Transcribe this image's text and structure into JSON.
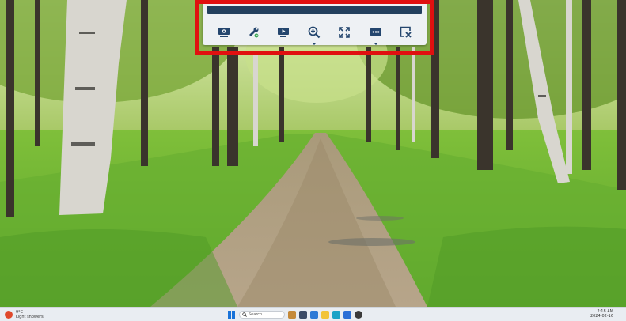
{
  "toolbar": {
    "title": "",
    "buttons": [
      {
        "name": "monitor-settings",
        "icon": "monitor-gear-icon"
      },
      {
        "name": "remote-tools",
        "icon": "wrench-screwdriver-icon"
      },
      {
        "name": "display-options",
        "icon": "screen-play-icon"
      },
      {
        "name": "zoom",
        "icon": "zoom-in-icon"
      },
      {
        "name": "fullscreen",
        "icon": "fullscreen-arrows-icon"
      },
      {
        "name": "more-actions",
        "icon": "ellipsis-icon"
      },
      {
        "name": "disconnect",
        "icon": "close-session-icon"
      }
    ],
    "highlight_color": "#e01010",
    "title_bar_color": "#23405e",
    "icon_color": "#24466e"
  },
  "taskbar": {
    "weather_temp": "9°C",
    "weather_desc": "Light showers",
    "search_placeholder": "Search",
    "time": "2:18 AM",
    "date": "2024-02-16"
  }
}
